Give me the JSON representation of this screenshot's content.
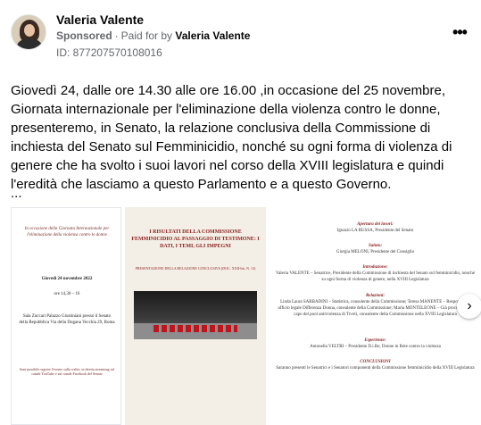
{
  "post": {
    "author": "Valeria Valente",
    "sponsored_label": "Sponsored",
    "separator": "·",
    "paid_for_prefix": "Paid for by",
    "paid_for_name": "Valeria Valente",
    "id_line": "ID: 877207570108016",
    "more_icon": "more-horizontal-icon",
    "more_label": "•••",
    "text": "Giovedì 24, dalle ore 14.30 alle ore 16.00 ,in occasione del 25 novembre, Giornata internazionale per l'eliminazione della violenza contro le donne, presenteremo, in Senato, la relazione conclusiva della Commissione di inchiesta del Senato sul Femminicidio, nonché su ogni forma di violenza di genere che ha svolto i suoi lavori nel corso della XVIII legislatura e quindi l'eredità che lasciamo a questo Parlamento e a questo Governo.",
    "ellipsis": "..."
  },
  "carousel": {
    "card1": {
      "head": "In occasione della Giornata Internazionale per l'eliminazione della violenza contro le donne",
      "date": "Giovedì 24 novembre 2022",
      "time": "ore 14,30 – 16",
      "place": "Sala Zuccari Palazzo Giustiniani presso il Senato della Repubblica Via della Dogana Vecchia 29, Roma",
      "foot": "Sarà possibile seguire l'evento sulla webtv, in diretta streaming sul canale YouTube e sul canale Facebook del Senato"
    },
    "card2": {
      "title": "I RISULTATI DELLA COMMISSIONE FEMMINICIDIO AL PASSAGGIO DI TESTIMONE: I DATI, I TEMI, GLI IMPEGNI",
      "subtitle": "PRESENTAZIONE DELLA RELAZIONE CONCLUSIVA (DOC. XXII-bis, N. 13)"
    },
    "card3": {
      "blocks": [
        {
          "label": "Apertura dei lavori:",
          "body": "Ignazio LA RUSSA, Presidente del Senato"
        },
        {
          "label": "Saluto:",
          "body": "Giorgia MELONI, Presidente del Consiglio"
        },
        {
          "label": "Introduzione:",
          "body": "Valeria VALENTE – Senatrice, Presidente della Commissione di inchiesta del Senato sul femminicidio, nonché su ogni forma di violenza di genere, nella XVIII Legislatura"
        },
        {
          "label": "Relazioni:",
          "body": "Linda Laura SABBADINI – Statistica, consulente della Commissione; Teresa MANENTE – Responsabile ufficio legale Differenza Donna, consulente della Commissione; Maria MONTELEONE – Già procuratrice a capo del pool antiviolenza di Tivoli, consulente della Commissione nella XVIII Legislatura"
        },
        {
          "label": "Esperienze:",
          "body": "Antonella VELTRI – Presidente D.i.Re, Donne in Rete contro la violenza"
        },
        {
          "label": "CONCLUSIONI",
          "body": "Saranno presenti le Senatrici e i Senatori componenti della Commissione femminicidio della XVIII Legislatura"
        }
      ]
    },
    "next_icon": "chevron-right-icon",
    "next_label": "›"
  }
}
